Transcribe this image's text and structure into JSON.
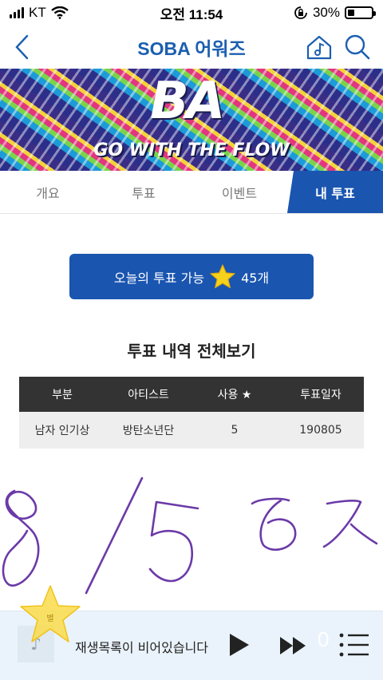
{
  "status_bar": {
    "carrier": "KT",
    "time": "오전 11:54",
    "battery": "30%",
    "battery_level": 0.3
  },
  "header": {
    "title": "SOBA 어워즈",
    "back_icon": "chevron-left-icon",
    "home_icon": "home-music-icon",
    "search_icon": "search-icon"
  },
  "banner": {
    "logo_text": "BA",
    "slogan": "GO WITH THE FLOW"
  },
  "tabs": [
    {
      "label": "개요",
      "active": false
    },
    {
      "label": "투표",
      "active": false
    },
    {
      "label": "이벤트",
      "active": false
    },
    {
      "label": "내 투표",
      "active": true
    }
  ],
  "vote_count": {
    "prefix": "오늘의 투표 가능",
    "count": "45개",
    "icon": "star-icon"
  },
  "history": {
    "title": "투표 내역 전체보기",
    "columns": [
      "부분",
      "아티스트",
      "사용 ★",
      "투표일자"
    ],
    "rows": [
      [
        "남자 인기상",
        "방탄소년단",
        "5",
        "190805"
      ]
    ]
  },
  "floating_star": {
    "label": "별"
  },
  "player": {
    "empty_text": "재생목록이 비어있습니다",
    "count": "0"
  },
  "colors": {
    "primary": "#1a55b0",
    "title": "#1b5fb0",
    "table_header": "#333333",
    "table_row": "#eeeeee",
    "player_bg": "#eaf3fb",
    "ink": "#6b3aa8"
  }
}
